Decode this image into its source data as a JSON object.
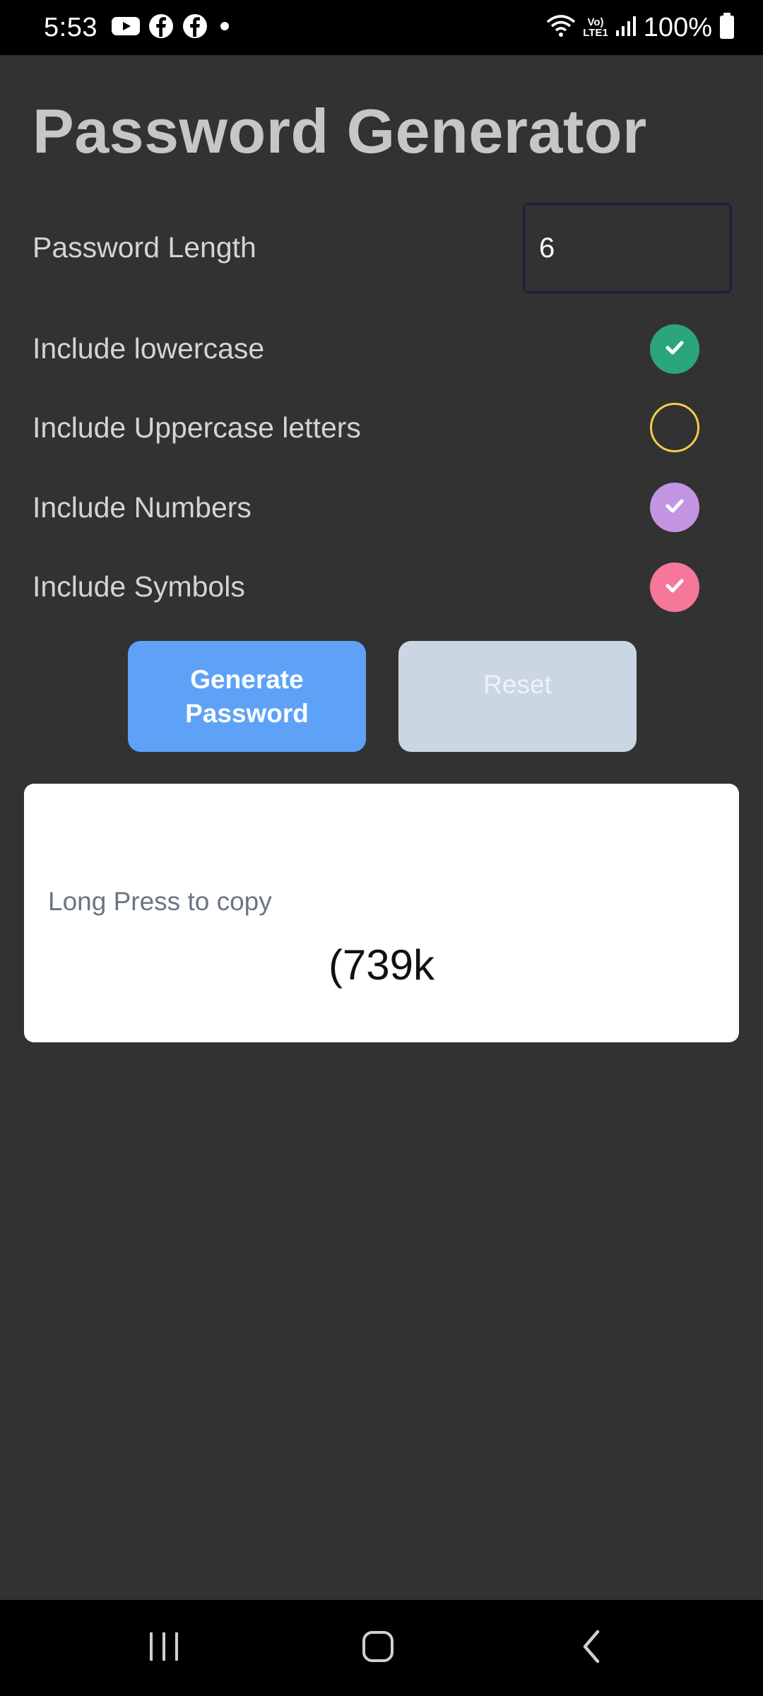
{
  "status_bar": {
    "time": "5:53",
    "left_icons": [
      "youtube-icon",
      "facebook-icon",
      "facebook-icon",
      "notification-dot-icon"
    ],
    "lte_top": "Vo)",
    "lte_bottom": "LTE1",
    "battery": "100%"
  },
  "app": {
    "title": "Password Generator"
  },
  "form": {
    "length_label": "Password Length",
    "length_value": "6",
    "options": [
      {
        "label": "Include lowercase",
        "checked": true,
        "color": "#2aa57d"
      },
      {
        "label": "Include Uppercase letters",
        "checked": false,
        "color": "#f2cf4b"
      },
      {
        "label": "Include Numbers",
        "checked": true,
        "color": "#c394e2"
      },
      {
        "label": "Include Symbols",
        "checked": true,
        "color": "#f7779b"
      }
    ]
  },
  "buttons": {
    "generate_line1": "Generate",
    "generate_line2": "Password",
    "reset": "Reset"
  },
  "result": {
    "hint": "Long Press to copy",
    "password": "(739k"
  },
  "colors": {
    "background": "#323232",
    "generate_button": "#5ea2f8",
    "reset_button": "#cbd6e3"
  }
}
